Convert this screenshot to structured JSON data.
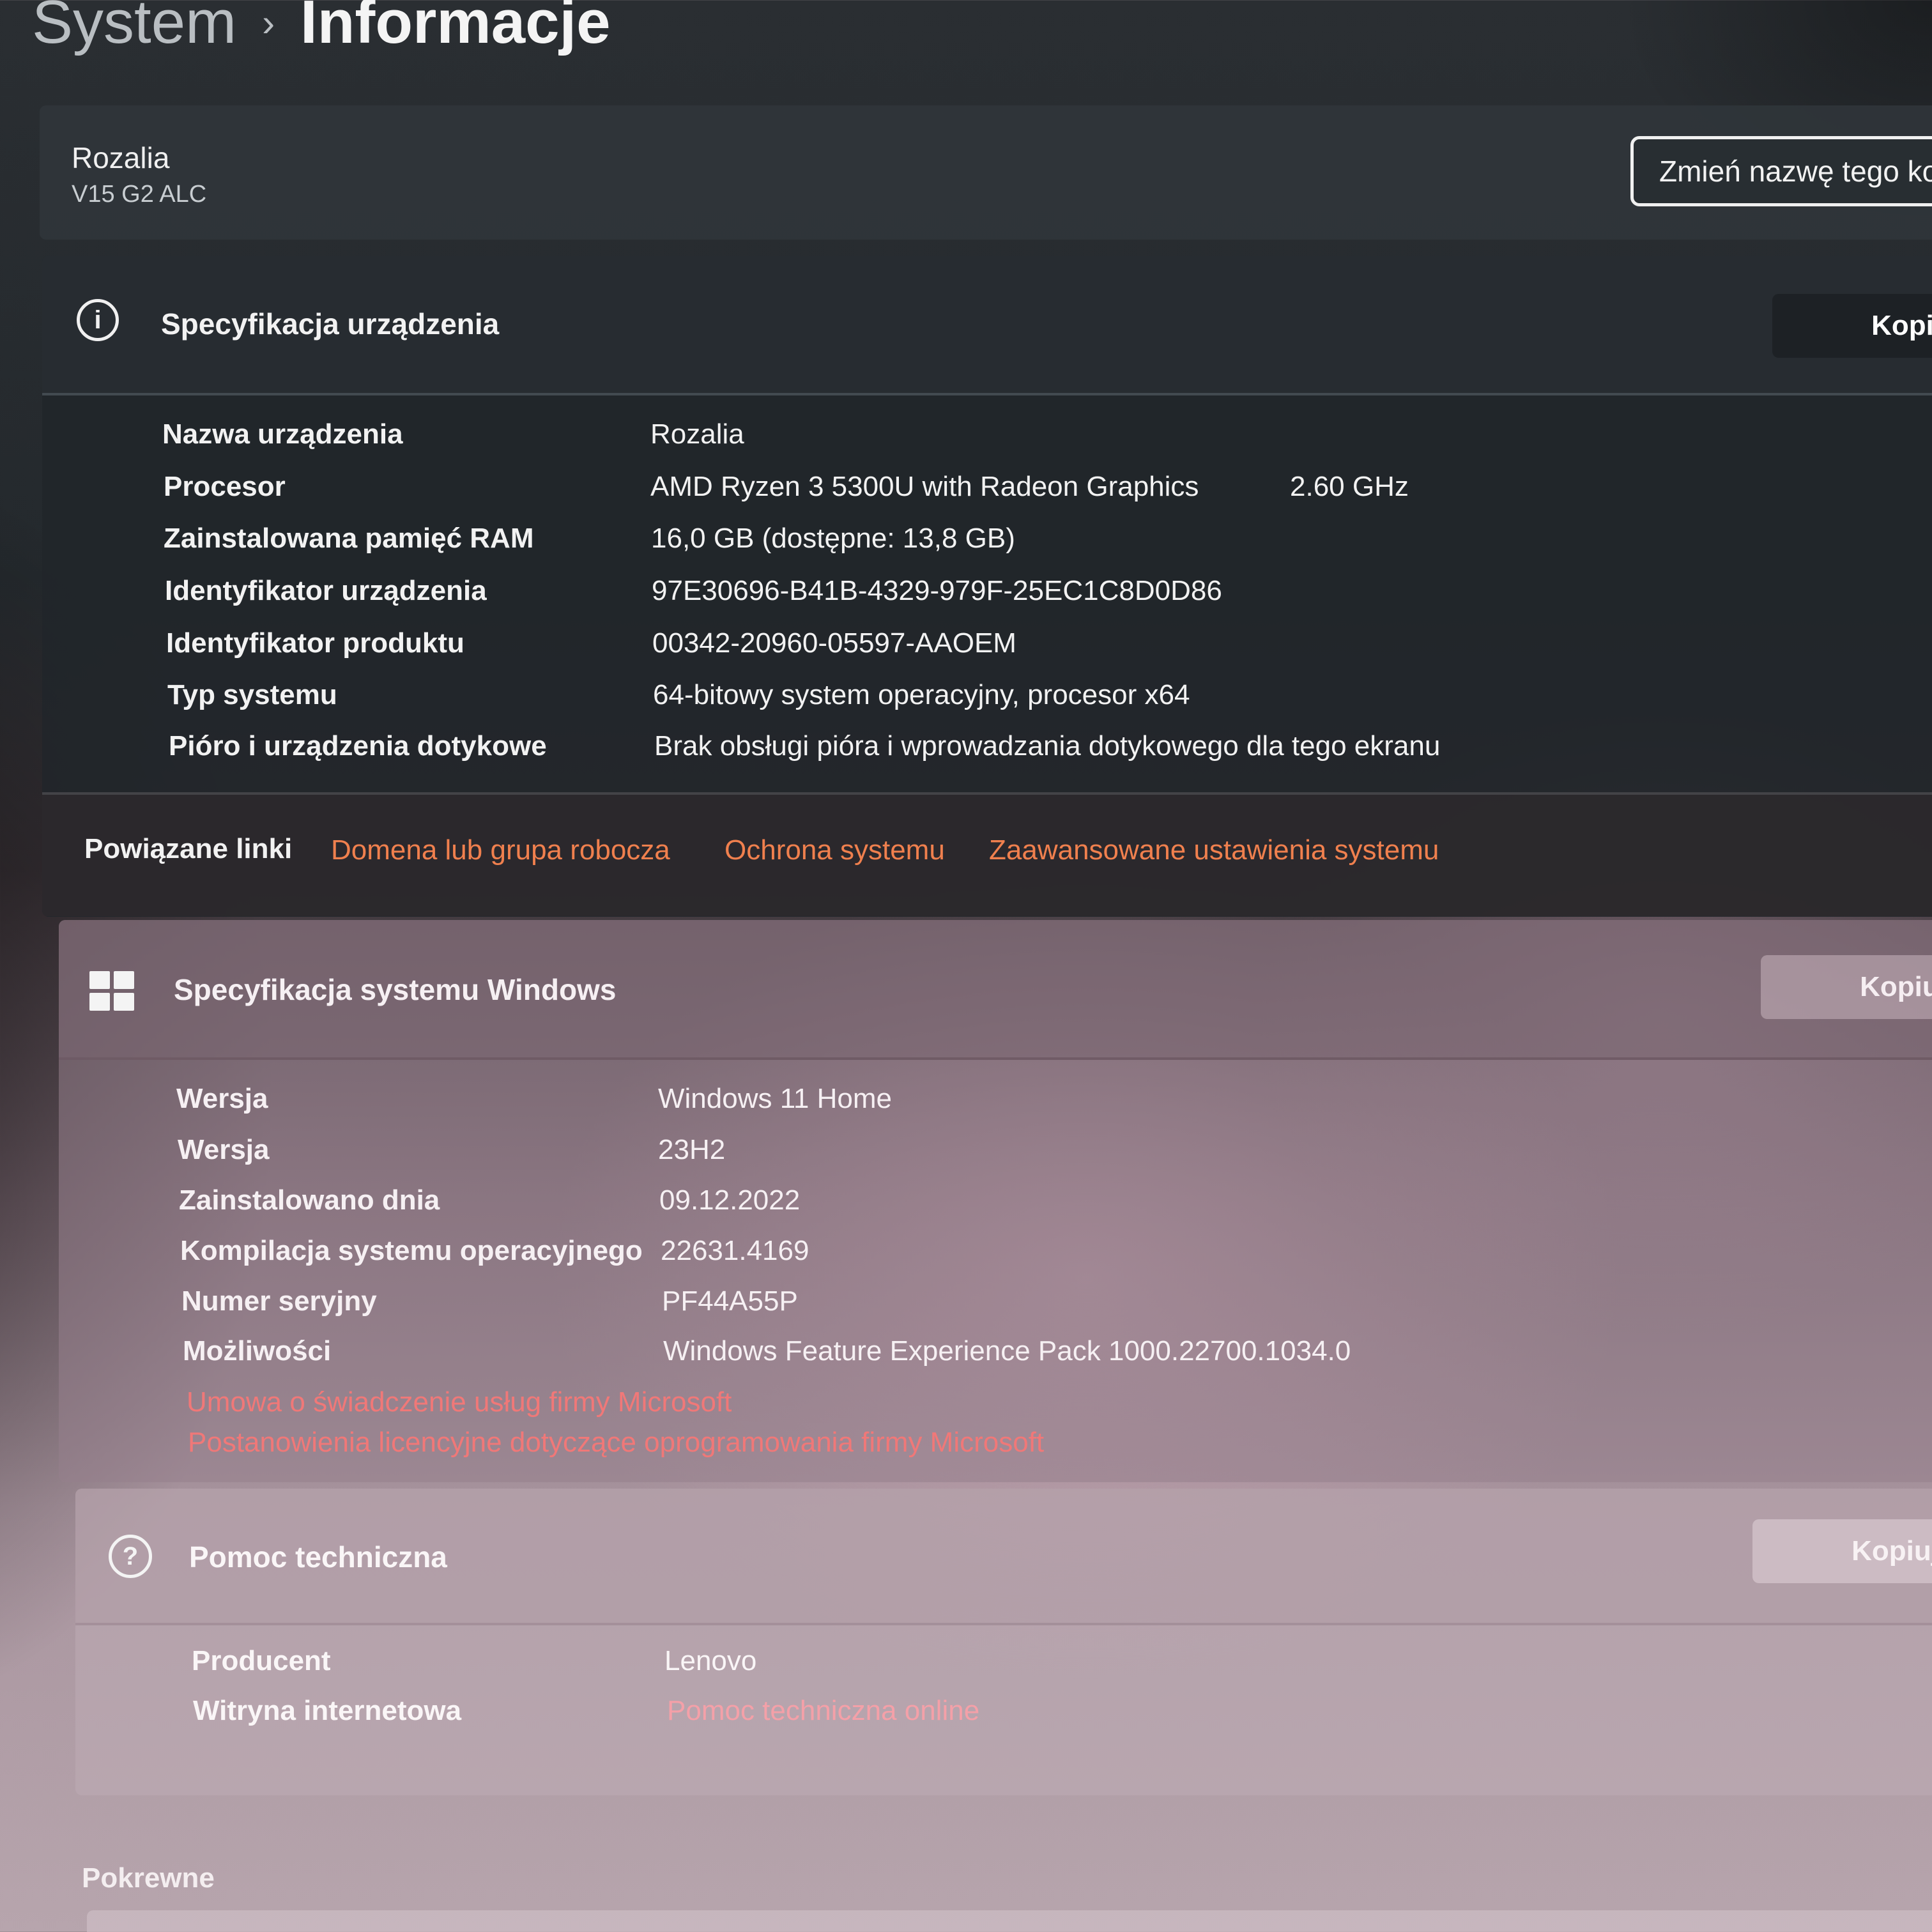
{
  "header": {
    "parent": "System",
    "separator": "›",
    "current": "Informacje"
  },
  "device": {
    "name": "Rozalia",
    "model": "V15 G2 ALC",
    "rename_button": "Zmień nazwę tego ko"
  },
  "device_spec": {
    "title": "Specyfikacja urządzenia",
    "copy_label": "Kopiuj",
    "icon": "info-icon",
    "rows": [
      {
        "label": "Nazwa urządzenia",
        "value": "Rozalia",
        "extra": ""
      },
      {
        "label": "Procesor",
        "value": "AMD Ryzen 3 5300U with Radeon Graphics",
        "extra": "2.60 GHz"
      },
      {
        "label": "Zainstalowana pamięć RAM",
        "value": "16,0 GB (dostępne: 13,8 GB)",
        "extra": ""
      },
      {
        "label": "Identyfikator urządzenia",
        "value": "97E30696-B41B-4329-979F-25EC1C8D0D86",
        "extra": ""
      },
      {
        "label": "Identyfikator produktu",
        "value": "00342-20960-05597-AAOEM",
        "extra": ""
      },
      {
        "label": "Typ systemu",
        "value": "64-bitowy system operacyjny, procesor x64",
        "extra": ""
      },
      {
        "label": "Pióro i urządzenia dotykowe",
        "value": "Brak obsługi pióra i wprowadzania dotykowego dla tego ekranu",
        "extra": ""
      }
    ]
  },
  "related_links": {
    "title": "Powiązane linki",
    "links": [
      "Domena lub grupa robocza",
      "Ochrona systemu",
      "Zaawansowane ustawienia systemu"
    ]
  },
  "windows_spec": {
    "title": "Specyfikacja systemu Windows",
    "copy_label": "Kopiuj",
    "icon": "windows-logo-icon",
    "rows": [
      {
        "label": "Wersja",
        "value": "Windows 11 Home"
      },
      {
        "label": "Wersja",
        "value": "23H2"
      },
      {
        "label": "Zainstalowano dnia",
        "value": "09.12.2022"
      },
      {
        "label": "Kompilacja systemu operacyjnego",
        "value": "22631.4169"
      },
      {
        "label": "Numer seryjny",
        "value": "PF44A55P"
      },
      {
        "label": "Możliwości",
        "value": "Windows Feature Experience Pack 1000.22700.1034.0"
      }
    ],
    "links": [
      "Umowa o świadczenie usług firmy Microsoft",
      "Postanowienia licencyjne dotyczące oprogramowania firmy Microsoft"
    ]
  },
  "support": {
    "title": "Pomoc techniczna",
    "copy_label": "Kopiuj",
    "icon": "help-icon",
    "rows": [
      {
        "label": "Producent",
        "value": "Lenovo"
      },
      {
        "label": "Witryna internetowa",
        "value": "Pomoc techniczna online"
      }
    ]
  },
  "related_bottom": "Pokrewne",
  "colors": {
    "link_orange": "#f0804e",
    "link_red": "#f07878",
    "dark_panel": "#21262a"
  }
}
